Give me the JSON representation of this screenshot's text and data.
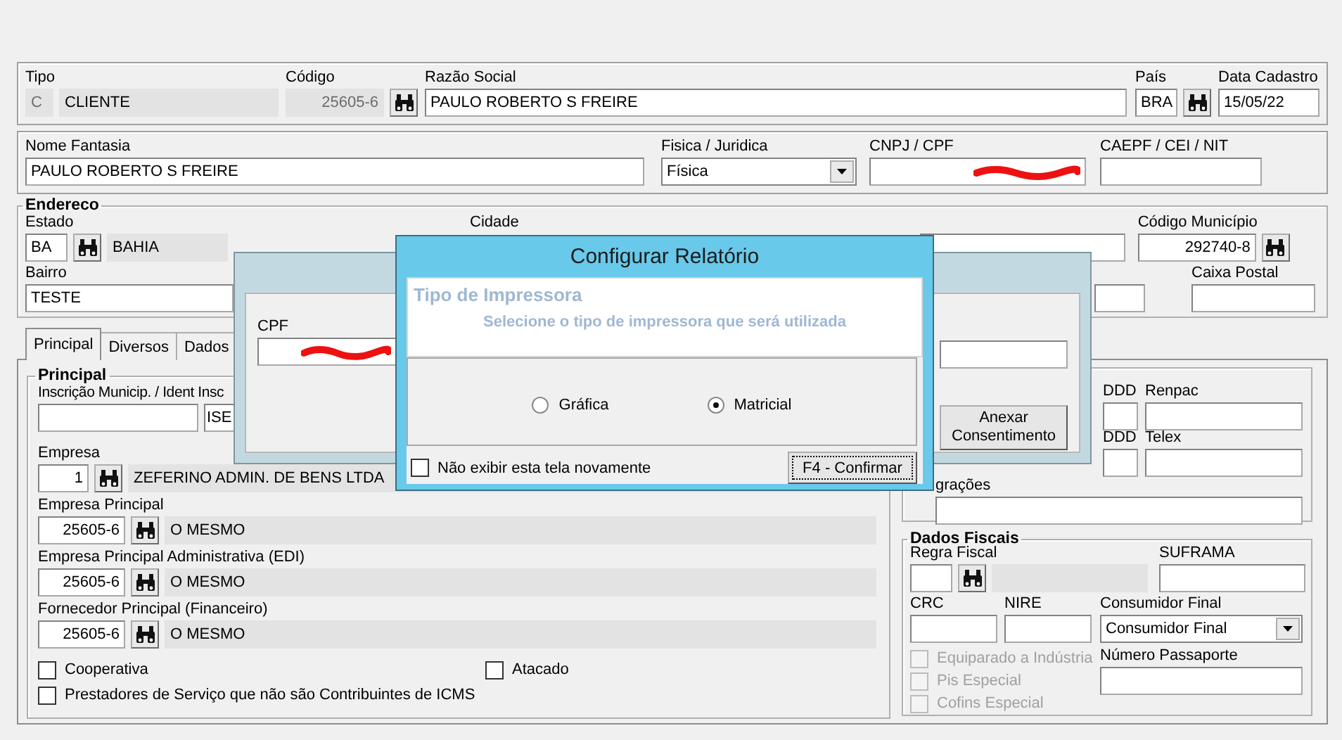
{
  "header": {
    "tipo": {
      "label": "Tipo",
      "code": "C",
      "value": "CLIENTE",
      "disabled": true
    },
    "codigo": {
      "label": "Código",
      "value": "25605-6",
      "disabled": true
    },
    "razao_social": {
      "label": "Razão Social",
      "value": "PAULO ROBERTO S FREIRE"
    },
    "pais": {
      "label": "País",
      "value": "BRA"
    },
    "data_cadastro": {
      "label": "Data Cadastro",
      "value": "15/05/22"
    }
  },
  "identity": {
    "nome_fantasia": {
      "label": "Nome Fantasia",
      "value": "PAULO ROBERTO S FREIRE"
    },
    "fisica_juridica": {
      "label": "Fisica / Juridica",
      "value": "Física"
    },
    "cnpj_cpf": {
      "label": "CNPJ / CPF",
      "redacted": true
    },
    "caepf": {
      "label": "CAEPF / CEI / NIT"
    }
  },
  "endereco": {
    "title": "Endereco",
    "estado": {
      "label": "Estado",
      "code": "BA",
      "value": "BAHIA"
    },
    "cidade": {
      "label": "Cidade"
    },
    "codigo_municipio": {
      "label": "Código Município",
      "value": "292740-8"
    },
    "bairro": {
      "label": "Bairro",
      "value": "TESTE"
    },
    "caixa_postal": {
      "label": "Caixa Postal"
    }
  },
  "tabs": [
    {
      "label": "Principal",
      "selected": true
    },
    {
      "label": "Diversos",
      "selected": false
    },
    {
      "label": "Dados",
      "selected": false
    }
  ],
  "principal": {
    "title": "Principal",
    "inscricao": {
      "label": "Inscrição Municip. / Ident Insc",
      "value_2": "ISE"
    },
    "empresa": {
      "label": "Empresa",
      "code": "1",
      "value": "ZEFERINO ADMIN. DE BENS LTDA"
    },
    "lookups": [
      {
        "label": "Empresa Principal",
        "code": "25605-6",
        "value": "O MESMO"
      },
      {
        "label": "Empresa Principal Administrativa (EDI)",
        "code": "25605-6",
        "value": "O MESMO"
      },
      {
        "label": "Fornecedor Principal (Financeiro)",
        "code": "25605-6",
        "value": "O MESMO"
      }
    ],
    "checkboxes": [
      {
        "label": "Cooperativa",
        "checked": false
      },
      {
        "label": "Atacado",
        "checked": false
      },
      {
        "label": "Prestadores de Serviço que não são Contribuintes de ICMS",
        "checked": false
      }
    ]
  },
  "contato": {
    "rows": [
      {
        "ddd_label": "DDD",
        "label": "Renpac"
      },
      {
        "ddd_label": "DDD",
        "label": "Telex"
      }
    ],
    "integracoes": {
      "label": "grações"
    }
  },
  "dados_fiscais": {
    "title": "Dados Fiscais",
    "regra_fiscal": {
      "label": "Regra Fiscal"
    },
    "suframa": {
      "label": "SUFRAMA"
    },
    "crc": {
      "label": "CRC"
    },
    "nire": {
      "label": "NIRE"
    },
    "consumidor_final": {
      "label": "Consumidor Final",
      "value": "Consumidor Final"
    },
    "checkboxes": [
      {
        "label": "Equiparado a Indústria",
        "checked": false,
        "disabled": true
      },
      {
        "label": "Pis Especial",
        "checked": false,
        "disabled": true
      },
      {
        "label": "Cofins Especial",
        "checked": false,
        "disabled": true
      }
    ],
    "passaporte": {
      "label": "Número Passaporte"
    }
  },
  "consent_dialog": {
    "cpf": {
      "label": "CPF",
      "redacted": true
    },
    "button": "Anexar Consentimento"
  },
  "config_dialog": {
    "title": "Configurar Relatório",
    "heading": "Tipo de Impressora",
    "subtitle": "Selecione o tipo de impressora que será utilizada",
    "options": [
      {
        "label": "Gráfica",
        "selected": false
      },
      {
        "label": "Matricial",
        "selected": true
      }
    ],
    "dont_show": {
      "label": "Não exibir esta tela novamente",
      "checked": false
    },
    "confirm": "F4 - Confirmar"
  }
}
